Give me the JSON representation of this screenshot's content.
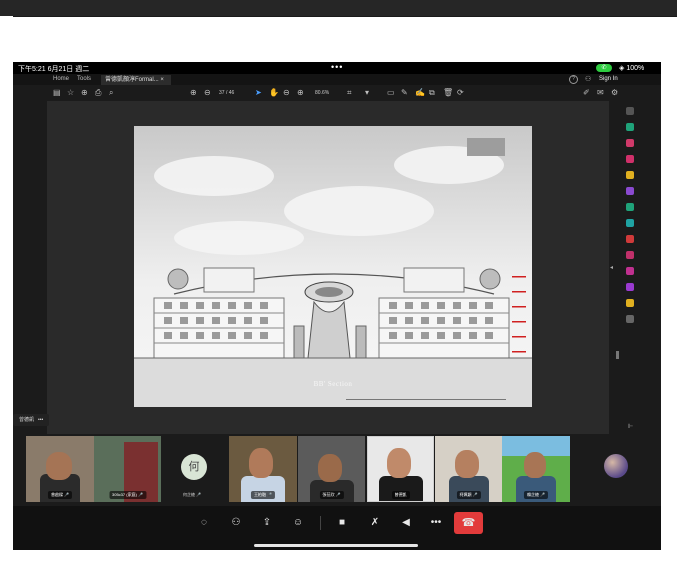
{
  "status": {
    "time": "下午5:21  6月21日 週二",
    "dots": "•••",
    "call_icon": "phone-icon",
    "wifi_battery": "◈ 100%"
  },
  "tabs": {
    "home": "Home",
    "tools": "Tools",
    "doc_tab": "曾德凱顏淳Formal... ×",
    "sign_in": "Sign In"
  },
  "toolbar": {
    "page_display": "37 / 46",
    "zoom_display": "80.6%"
  },
  "drawing": {
    "section_label": "BB' Section"
  },
  "share_badge": {
    "label": "曾德凱",
    "more": "•••"
  },
  "participants": [
    {
      "name": "曾啟樑 🎤",
      "initial": ""
    },
    {
      "name": "305c37 (家庭) 🎤",
      "initial": ""
    },
    {
      "name": "何芷綾 🎤",
      "initial": "何"
    },
    {
      "name": "王柏融 🎤",
      "initial": ""
    },
    {
      "name": "張莅欣 🎤",
      "initial": ""
    },
    {
      "name": "曾德凱",
      "initial": ""
    },
    {
      "name": "柯姵穎 🎤",
      "initial": ""
    },
    {
      "name": "賴芷綾 🎤",
      "initial": ""
    }
  ],
  "controls": {
    "chat": "chat-icon",
    "participants": "participants-icon",
    "share": "share-screen-icon",
    "reactions": "reaction-icon",
    "video": "video-off-icon",
    "mic": "mic-off-icon",
    "speaker": "speaker-icon",
    "more": "•••",
    "end": "end-call-icon"
  },
  "colors": {
    "end_call": "#e23b3b",
    "call_pill": "#2ecc40",
    "annotation_red": "#d02020",
    "tool_pink": "#e0306a"
  }
}
